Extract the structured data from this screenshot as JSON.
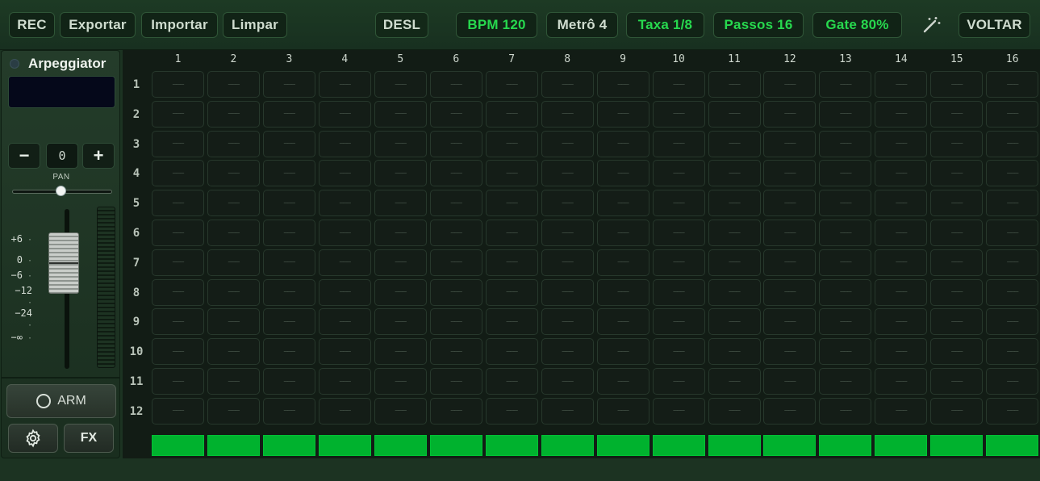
{
  "toolbar": {
    "left_buttons": [
      "REC",
      "Exportar",
      "Importar",
      "Limpar"
    ],
    "mode": "DESL",
    "bpm": "BPM 120",
    "metro": "Metrô 4",
    "rate": "Taxa 1/8",
    "steps": "Passos 16",
    "gate": "Gate 80%",
    "wand_icon": "magic-wand-icon",
    "back": "VOLTAR",
    "accent_color": "#27d84e"
  },
  "track": {
    "name": "Arpeggiator",
    "transpose_minus": "−",
    "transpose_value": "0",
    "transpose_plus": "+",
    "pan_label": "PAN",
    "pan_value": 0.5,
    "fader_db_labels": [
      "+6",
      "0",
      "−6",
      "−12",
      "−24",
      "−∞"
    ],
    "arm_label": "ARM",
    "settings_icon": "gear-icon",
    "fx_label": "FX"
  },
  "grid": {
    "columns": [
      "1",
      "2",
      "3",
      "4",
      "5",
      "6",
      "7",
      "8",
      "9",
      "10",
      "11",
      "12",
      "13",
      "14",
      "15",
      "16"
    ],
    "rows": [
      "1",
      "2",
      "3",
      "4",
      "5",
      "6",
      "7",
      "8",
      "9",
      "10",
      "11",
      "12"
    ],
    "empty_cell": "———",
    "gate_color": "#00b22e"
  }
}
